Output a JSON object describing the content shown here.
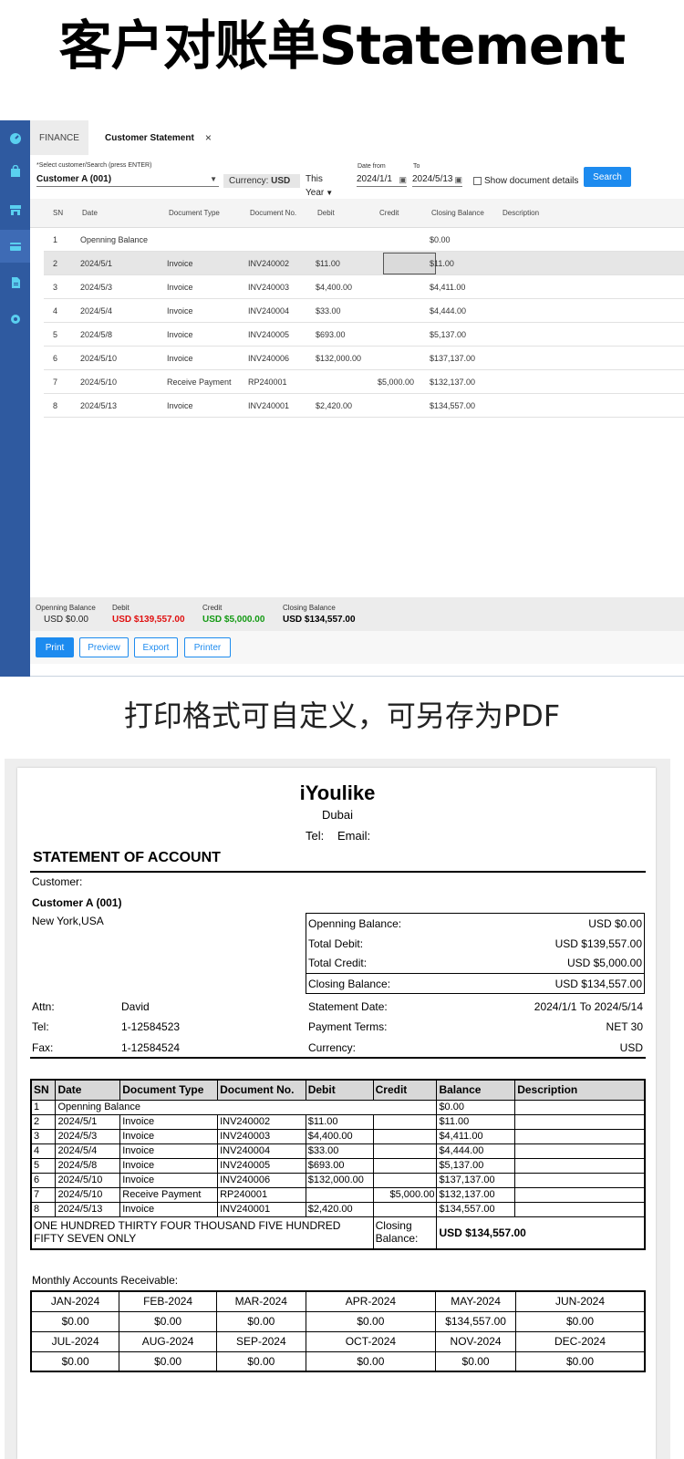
{
  "headline": "客户对账单Statement",
  "subheadline": "打印格式可自定义，可另存为PDF",
  "sidebar": {
    "icons": [
      "dashboard-icon",
      "shopping-bag-icon",
      "store-icon",
      "card-icon",
      "document-icon",
      "settings-icon"
    ],
    "active_index": 3,
    "accent_color": "#5ad0f0",
    "background_color": "#2f5aa0"
  },
  "tabs": {
    "finance": "FINANCE",
    "statement": "Customer Statement",
    "close": "×"
  },
  "filters": {
    "customer_label": "*Select customer/Search (press ENTER)",
    "customer_value": "Customer A (001)",
    "currency_label": "Currency:",
    "currency_value": "USD",
    "period_value": "This Year",
    "date_from_label": "Date from",
    "date_from_value": "2024/1/1",
    "date_to_label": "To",
    "date_to_value": "2024/5/13",
    "show_details_label": "Show document details",
    "search_label": "Search"
  },
  "grid": {
    "headers": [
      "SN",
      "Date",
      "Document Type",
      "Document No.",
      "Debit",
      "Credit",
      "Closing Balance",
      "Description"
    ],
    "rows": [
      [
        "1",
        "Openning Balance",
        "",
        "",
        "",
        "",
        "$0.00",
        ""
      ],
      [
        "2",
        "2024/5/1",
        "Invoice",
        "INV240002",
        "$11.00",
        "",
        "$11.00",
        ""
      ],
      [
        "3",
        "2024/5/3",
        "Invoice",
        "INV240003",
        "$4,400.00",
        "",
        "$4,411.00",
        ""
      ],
      [
        "4",
        "2024/5/4",
        "Invoice",
        "INV240004",
        "$33.00",
        "",
        "$4,444.00",
        ""
      ],
      [
        "5",
        "2024/5/8",
        "Invoice",
        "INV240005",
        "$693.00",
        "",
        "$5,137.00",
        ""
      ],
      [
        "6",
        "2024/5/10",
        "Invoice",
        "INV240006",
        "$132,000.00",
        "",
        "$137,137.00",
        ""
      ],
      [
        "7",
        "2024/5/10",
        "Receive Payment",
        "RP240001",
        "",
        "$5,000.00",
        "$132,137.00",
        ""
      ],
      [
        "8",
        "2024/5/13",
        "Invoice",
        "INV240001",
        "$2,420.00",
        "",
        "$134,557.00",
        ""
      ]
    ],
    "selected_row_index": 1
  },
  "summary": {
    "opening_label": "Openning Balance",
    "opening_value": "USD $0.00",
    "debit_label": "Debit",
    "debit_value": "USD $139,557.00",
    "debit_color": "#e01010",
    "credit_label": "Credit",
    "credit_value": "USD $5,000.00",
    "credit_color": "#149a14",
    "closing_label": "Closing Balance",
    "closing_value": "USD $134,557.00"
  },
  "actions": {
    "print": "Print",
    "preview": "Preview",
    "export": "Export",
    "printer": "Printer"
  },
  "statement": {
    "company": "iYoulike",
    "city": "Dubai",
    "tel_label": "Tel:",
    "email_label": "Email:",
    "title": "STATEMENT OF ACCOUNT",
    "customer_label": "Customer:",
    "customer_name": "Customer A  (001)",
    "customer_address": "New York,USA",
    "balances": [
      {
        "label": "Openning Balance:",
        "value": "USD $0.00"
      },
      {
        "label": "Total Debit:",
        "value": "USD $139,557.00"
      },
      {
        "label": "Total Credit:",
        "value": "USD $5,000.00"
      },
      {
        "label": "Closing Balance:",
        "value": "USD $134,557.00"
      }
    ],
    "contact": {
      "attn_label": "Attn:",
      "attn_value": "David",
      "tel_label": "Tel:",
      "tel_value": "1-12584523",
      "fax_label": "Fax:",
      "fax_value": "1-12584524"
    },
    "terms": {
      "statement_date_label": "Statement Date:",
      "statement_date_value": "2024/1/1 To 2024/5/14",
      "payment_terms_label": "Payment Terms:",
      "payment_terms_value": "NET 30",
      "currency_label": "Currency:",
      "currency_value": "USD"
    },
    "table_headers": [
      "SN",
      "Date",
      "Document Type",
      "Document No.",
      "Debit",
      "Credit",
      "Balance",
      "Description"
    ],
    "amount_words": "ONE HUNDRED THIRTY FOUR THOUSAND FIVE HUNDRED FIFTY SEVEN ONLY",
    "closing_label": "Closing Balance:",
    "closing_value": "USD $134,557.00",
    "monthly_label": "Monthly Accounts Receivable:",
    "months_row1": [
      "JAN-2024",
      "FEB-2024",
      "MAR-2024",
      "APR-2024",
      "MAY-2024",
      "JUN-2024"
    ],
    "values_row1": [
      "$0.00",
      "$0.00",
      "$0.00",
      "$0.00",
      "$134,557.00",
      "$0.00"
    ],
    "months_row2": [
      "JUL-2024",
      "AUG-2024",
      "SEP-2024",
      "OCT-2024",
      "NOV-2024",
      "DEC-2024"
    ],
    "values_row2": [
      "$0.00",
      "$0.00",
      "$0.00",
      "$0.00",
      "$0.00",
      "$0.00"
    ]
  }
}
